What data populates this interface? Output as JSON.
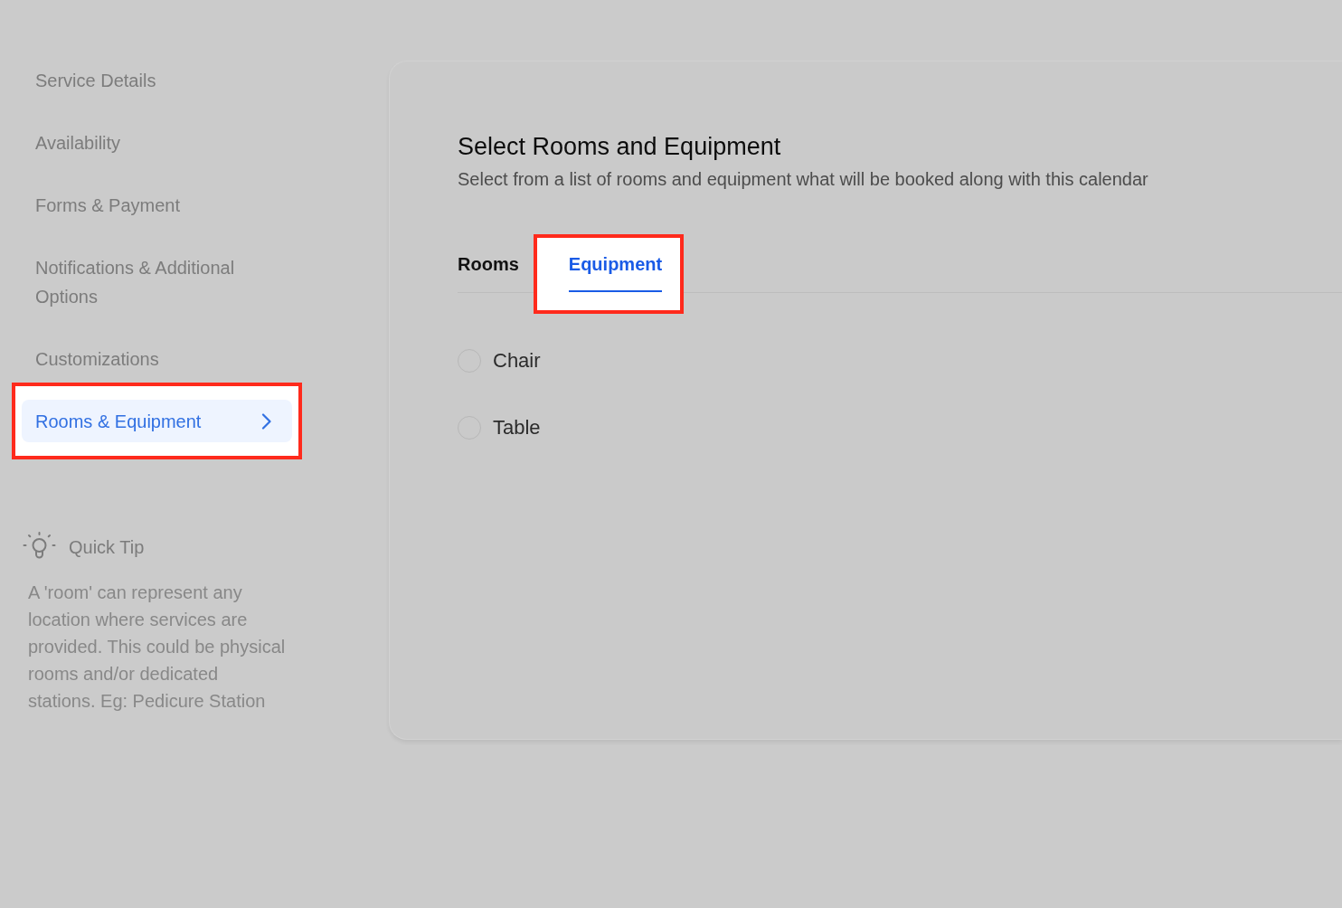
{
  "sidebar": {
    "items": [
      {
        "label": "Service Details",
        "selected": false,
        "highlighted": false
      },
      {
        "label": "Availability",
        "selected": false,
        "highlighted": false
      },
      {
        "label": "Forms & Payment",
        "selected": false,
        "highlighted": false
      },
      {
        "label": "Notifications & Additional Options",
        "selected": false,
        "highlighted": false
      },
      {
        "label": "Customizations",
        "selected": false,
        "highlighted": false
      },
      {
        "label": "Rooms & Equipment",
        "selected": true,
        "highlighted": true
      }
    ]
  },
  "quick_tip": {
    "title": "Quick Tip",
    "text": "A 'room' can represent any location where services are provided. This could be physical rooms and/or dedicated stations. Eg: Pedicure Station"
  },
  "panel": {
    "title": "Select Rooms and Equipment",
    "subtitle": "Select from a list of rooms and equipment what will be booked along with this calendar",
    "tabs": [
      {
        "label": "Rooms",
        "selected": false,
        "highlighted": false
      },
      {
        "label": "Equipment",
        "selected": true,
        "highlighted": true
      }
    ],
    "items": [
      {
        "label": "Chair",
        "checked": false
      },
      {
        "label": "Table",
        "checked": false
      }
    ]
  }
}
